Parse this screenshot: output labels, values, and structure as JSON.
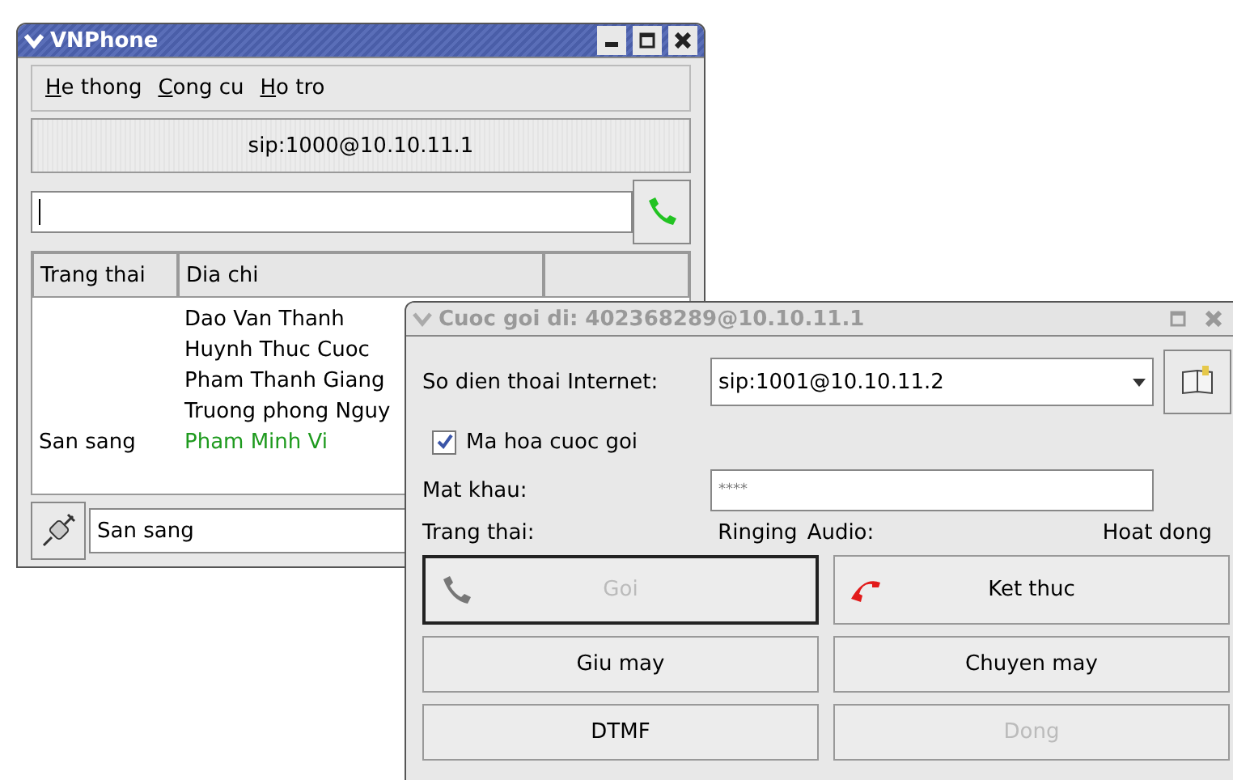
{
  "main_window": {
    "title": "VNPhone",
    "menu": [
      {
        "label": "He thong"
      },
      {
        "label": "Cong cu"
      },
      {
        "label": "Ho tro"
      }
    ],
    "account": "sip:1000@10.10.11.1",
    "table": {
      "columns": [
        "Trang thai",
        "Dia chi",
        ""
      ],
      "rows": [
        {
          "status": "",
          "name": "Dao Van Thanh",
          "color": "#000000"
        },
        {
          "status": "",
          "name": "Huynh Thuc Cuoc",
          "color": "#000000"
        },
        {
          "status": "",
          "name": "Pham Thanh Giang",
          "color": "#000000"
        },
        {
          "status": "",
          "name": "Truong phong Nguy",
          "color": "#000000"
        },
        {
          "status": "San sang",
          "name": "Pham Minh Vi",
          "color": "#1e9a1e"
        }
      ]
    },
    "status_field": "San sang"
  },
  "call_dialog": {
    "title": "Cuoc goi di: 402368289@10.10.11.1",
    "phone_label": "So dien thoai Internet:",
    "phone_value": "sip:1001@10.10.11.2",
    "encrypt": {
      "label": "Ma hoa cuoc goi",
      "checked": true
    },
    "password_label": "Mat khau:",
    "password_value": "****",
    "status_label": "Trang thai:",
    "status_value": "Ringing",
    "audio_label": "Audio:",
    "audio_value": "Hoat dong",
    "buttons": [
      {
        "label": "Goi",
        "kind": "call",
        "disabled": true,
        "focused": true
      },
      {
        "label": "Ket thuc",
        "kind": "hangup",
        "disabled": false,
        "focused": false
      },
      {
        "label": "Giu may",
        "kind": "plain",
        "disabled": false,
        "focused": false
      },
      {
        "label": "Chuyen may",
        "kind": "plain",
        "disabled": false,
        "focused": false
      },
      {
        "label": "DTMF",
        "kind": "plain",
        "disabled": false,
        "focused": false
      },
      {
        "label": "Dong",
        "kind": "plain",
        "disabled": true,
        "focused": false
      }
    ]
  }
}
